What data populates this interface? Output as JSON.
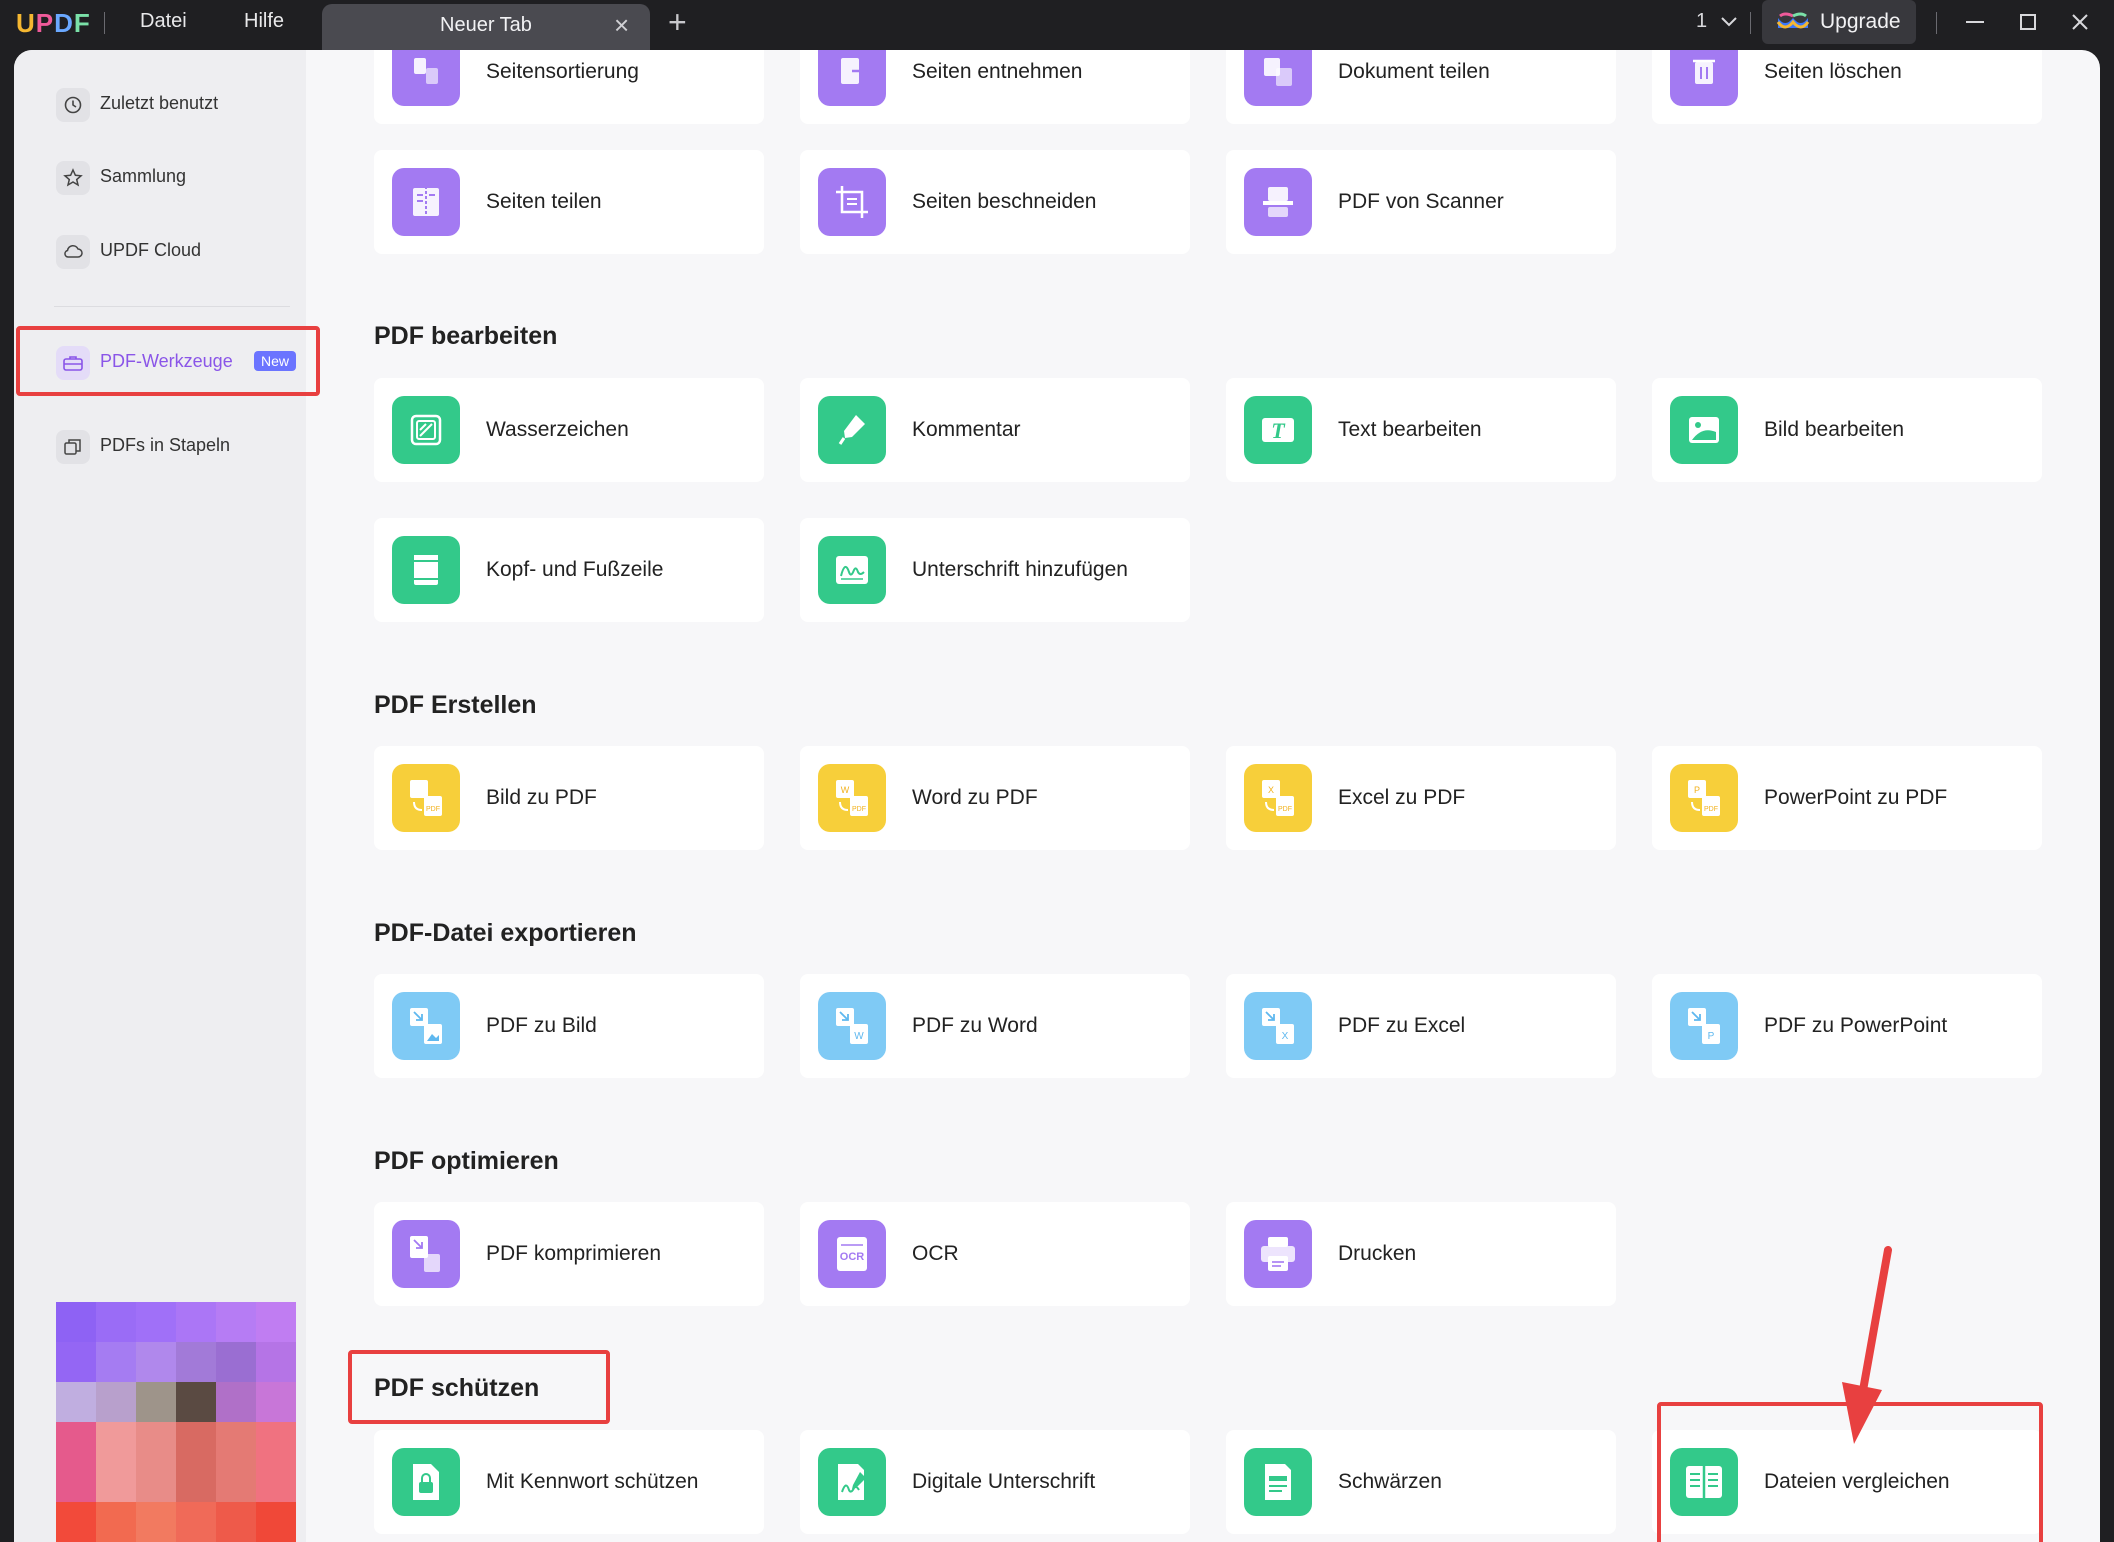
{
  "titlebar": {
    "logo": {
      "u": "U",
      "p": "P",
      "d": "D",
      "f": "F"
    },
    "menu": {
      "file": "Datei",
      "help": "Hilfe"
    },
    "tab": {
      "label": "Neuer Tab",
      "close": "×"
    },
    "add_tab": "+",
    "page_count": "1",
    "upgrade": "Upgrade"
  },
  "sidebar": {
    "items": [
      {
        "label": "Zuletzt benutzt",
        "icon": "clock-icon"
      },
      {
        "label": "Sammlung",
        "icon": "star-icon"
      },
      {
        "label": "UPDF Cloud",
        "icon": "cloud-icon"
      },
      {
        "label": "PDF-Werkzeuge",
        "icon": "toolbox-icon",
        "badge": "New",
        "active": true
      },
      {
        "label": "PDFs in Stapeln",
        "icon": "batch-icon"
      }
    ]
  },
  "sections": {
    "organize": {
      "row1": [
        "Seitensortierung",
        "Seiten entnehmen",
        "Dokument teilen",
        "Seiten löschen"
      ],
      "row2": [
        "Seiten teilen",
        "Seiten beschneiden",
        "PDF von Scanner"
      ]
    },
    "edit": {
      "title": "PDF bearbeiten",
      "items": [
        "Wasserzeichen",
        "Kommentar",
        "Text bearbeiten",
        "Bild bearbeiten",
        "Kopf- und Fußzeile",
        "Unterschrift hinzufügen"
      ]
    },
    "create": {
      "title": "PDF Erstellen",
      "items": [
        "Bild zu PDF",
        "Word zu PDF",
        "Excel zu PDF",
        "PowerPoint zu PDF"
      ]
    },
    "export": {
      "title": "PDF-Datei exportieren",
      "items": [
        "PDF zu Bild",
        "PDF zu Word",
        "PDF zu Excel",
        "PDF zu PowerPoint"
      ]
    },
    "optimize": {
      "title": "PDF optimieren",
      "items": [
        "PDF komprimieren",
        "OCR",
        "Drucken"
      ]
    },
    "protect": {
      "title": "PDF schützen",
      "items": [
        "Mit Kennwort schützen",
        "Digitale Unterschrift",
        "Schwärzen",
        "Dateien vergleichen"
      ]
    }
  },
  "colors": {
    "purple": "#a37af2",
    "green": "#33c98a",
    "yellow": "#f7cf3a",
    "blue": "#7fcaf5",
    "highlight": "#e84040",
    "accent": "#8a55e8"
  }
}
